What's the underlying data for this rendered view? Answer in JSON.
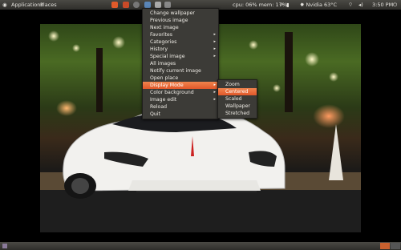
{
  "panel": {
    "applications": "Applications",
    "places": "Places",
    "sysmon": "cpu: 06% mem: 17%",
    "temp": "Nvidia 63°C",
    "clock": "3:50 PM"
  },
  "menu": {
    "items": [
      {
        "label": "Change wallpaper",
        "submenu": false
      },
      {
        "label": "Previous image",
        "submenu": false
      },
      {
        "label": "Next image",
        "submenu": false
      },
      {
        "label": "Favorites",
        "submenu": true
      },
      {
        "label": "Categories",
        "submenu": true
      },
      {
        "label": "History",
        "submenu": true
      },
      {
        "label": "Special image",
        "submenu": true
      },
      {
        "label": "All images",
        "submenu": false
      },
      {
        "label": "Notify current image",
        "submenu": false
      },
      {
        "label": "Open place",
        "submenu": false
      },
      {
        "label": "Display Mode",
        "submenu": true,
        "active": true
      },
      {
        "label": "Color background",
        "submenu": true
      },
      {
        "label": "Image edit",
        "submenu": true
      },
      {
        "label": "Reload",
        "submenu": false
      },
      {
        "label": "Quit",
        "submenu": false
      }
    ],
    "arrow": "▸"
  },
  "submenu": {
    "items": [
      {
        "label": "Zoom"
      },
      {
        "label": "Centered",
        "active": true
      },
      {
        "label": "Scaled"
      },
      {
        "label": "Wallpaper"
      },
      {
        "label": "Stretched"
      }
    ]
  },
  "colors": {
    "accent": "#e8632f",
    "panel": "#3c3b37"
  },
  "icons": {
    "panel_left": [
      "ubuntu-logo-icon",
      "app-launcher-icon"
    ],
    "panel_right": [
      "network-icon",
      "volume-icon",
      "mail-icon",
      "power-icon"
    ]
  }
}
